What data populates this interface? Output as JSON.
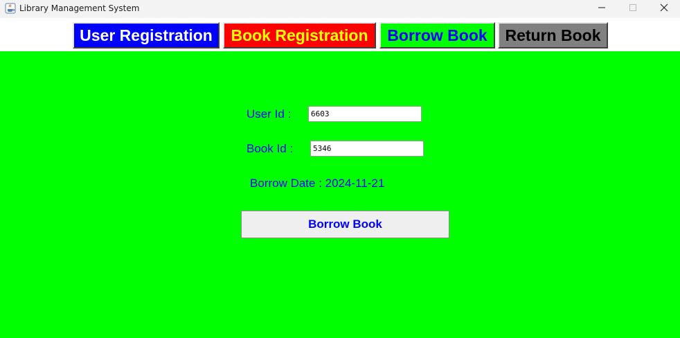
{
  "window": {
    "title": "Library Management System",
    "icon": "java-cup-icon",
    "controls": [
      "minimize-icon",
      "maximize-icon",
      "close-icon"
    ]
  },
  "nav": {
    "items": [
      {
        "label": "User Registration",
        "bg": "#0000ff",
        "fg": "#ffffff"
      },
      {
        "label": "Book Registration",
        "bg": "#ff0000",
        "fg": "#ffff00"
      },
      {
        "label": "Borrow Book",
        "bg": "#00ff00",
        "fg": "#0000ff"
      },
      {
        "label": "Return Book",
        "bg": "#808080",
        "fg": "#000000"
      }
    ]
  },
  "form": {
    "background": "#00ff00",
    "text_color": "#0000ff",
    "user_id_label": "User Id :",
    "user_id_value": "6603",
    "book_id_label": "Book Id :",
    "book_id_value": "5346",
    "borrow_date_text": "Borrow Date : 2024-11-21",
    "submit_label": "Borrow Book"
  }
}
